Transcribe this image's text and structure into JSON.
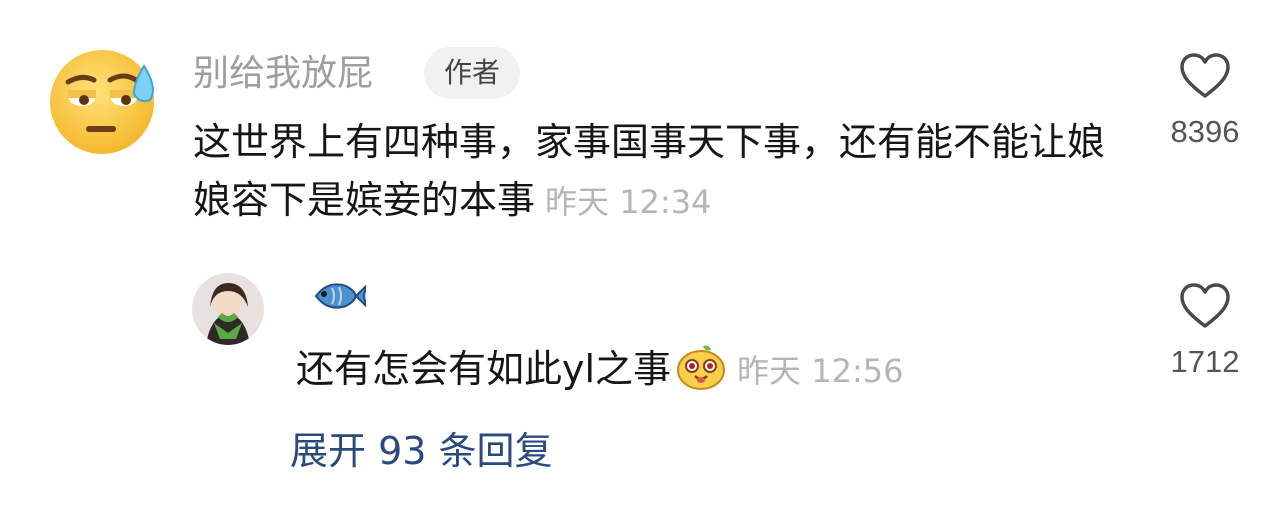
{
  "comment": {
    "avatar_icon": "sweat-smile-emoji-icon",
    "username": "别给我放屁",
    "badge": "作者",
    "text": "这世界上有四种事，家事国事天下事，还有能不能让娘娘容下是嫔妾的本事",
    "time": "昨天 12:34",
    "likes": "8396"
  },
  "reply": {
    "avatar_icon": "user-photo-avatar",
    "name_icon": "fish-emoji-icon",
    "text": "还有怎会有如此yl之事",
    "inline_emoji": "lemon-dog-emoji-icon",
    "time": "昨天 12:56",
    "likes": "1712"
  },
  "expand_label": "展开 93 条回复",
  "colors": {
    "username": "#9e9e9e",
    "text": "#161616",
    "time": "#b5b5b5",
    "link": "#2a4a7f",
    "badge_bg": "#f1f1f1"
  }
}
